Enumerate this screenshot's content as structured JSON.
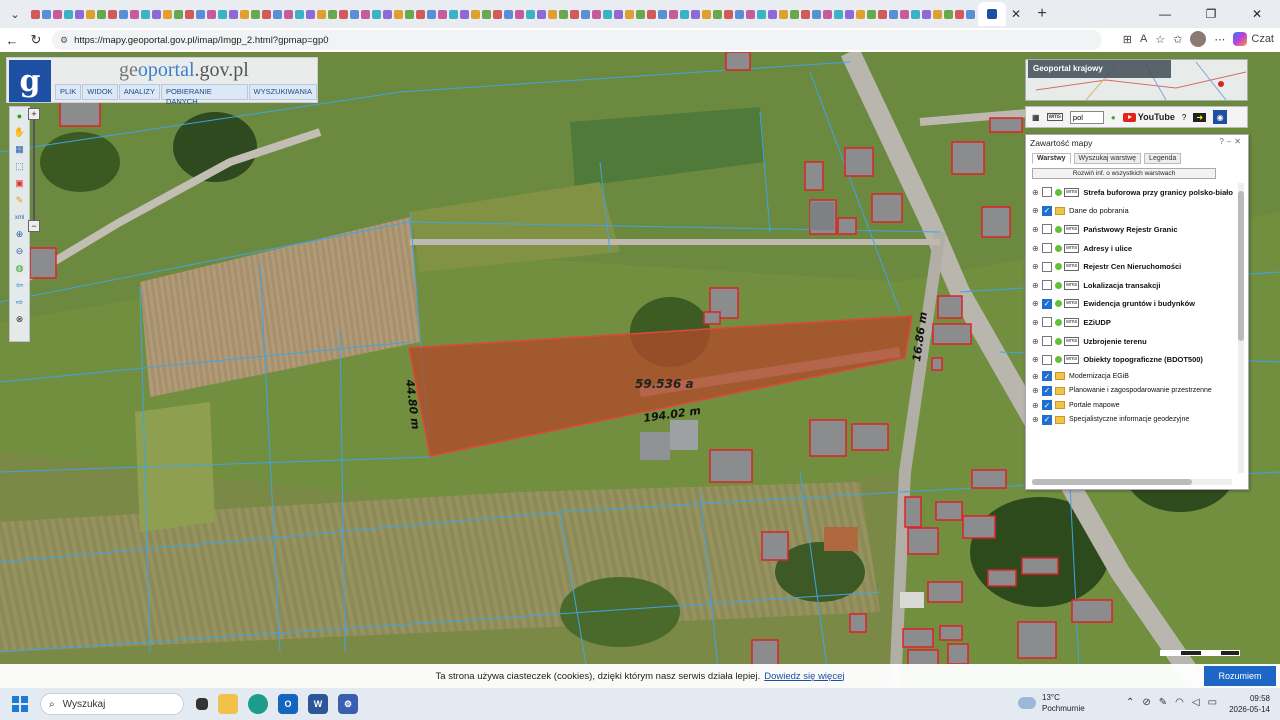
{
  "browser": {
    "active_tab_icon": "geoportal-favicon",
    "url": "https://mapy.geoportal.gov.pl/imap/Imgp_2.html?gpmap=gp0",
    "copilot_label": "Czat"
  },
  "geoportal": {
    "logo_letter": "g",
    "title_prefix": "ge",
    "title_mid": "oportal",
    "title_suffix": ".gov.pl",
    "menu": [
      "PLIK",
      "WIDOK",
      "ANALIZY",
      "POBIERANIE DANYCH",
      "WYSZUKIWANIA"
    ]
  },
  "overview_map": {
    "label": "Geoportal krajowy"
  },
  "utility_bar": {
    "language": "pol",
    "youtube_label": "YouTube"
  },
  "layer_panel": {
    "title": "Zawartość mapy",
    "tabs": [
      "Warstwy",
      "Wyszukaj warstwę",
      "Legenda"
    ],
    "expand_button": "Rozwiń inf. o wszystkich warstwach",
    "layers": [
      {
        "name": "Strefa buforowa przy granicy polsko-biało",
        "checked": false,
        "bold": true,
        "kind": "service"
      },
      {
        "name": "Dane do pobrania",
        "checked": true,
        "bold": false,
        "kind": "folder"
      },
      {
        "name": "Państwowy Rejestr Granic",
        "checked": false,
        "bold": true,
        "kind": "service"
      },
      {
        "name": "Adresy i ulice",
        "checked": false,
        "bold": true,
        "kind": "service"
      },
      {
        "name": "Rejestr Cen Nieruchomości",
        "checked": false,
        "bold": true,
        "kind": "service"
      },
      {
        "name": "Lokalizacja transakcji",
        "checked": false,
        "bold": true,
        "kind": "service"
      },
      {
        "name": "Ewidencja gruntów i budynków",
        "checked": true,
        "bold": true,
        "kind": "service"
      },
      {
        "name": "EZiUDP",
        "checked": false,
        "bold": true,
        "kind": "service"
      },
      {
        "name": "Uzbrojenie terenu",
        "checked": false,
        "bold": true,
        "kind": "service"
      },
      {
        "name": "Obiekty topograficzne (BDOT500)",
        "checked": false,
        "bold": true,
        "kind": "service"
      },
      {
        "name": "Modernizacja EGiB",
        "checked": true,
        "bold": false,
        "kind": "folder"
      },
      {
        "name": "Planowanie i zagospodarowanie przestrzenne",
        "checked": true,
        "bold": false,
        "kind": "folder"
      },
      {
        "name": "Portale mapowe",
        "checked": true,
        "bold": false,
        "kind": "folder"
      },
      {
        "name": "Specjalistyczne informacje geodezyjne",
        "checked": true,
        "bold": false,
        "kind": "folder"
      }
    ]
  },
  "measurement": {
    "area": "59.536 a",
    "side_left": "44.80 m",
    "side_bottom": "194.02 m",
    "side_right": "16.86 m"
  },
  "cookie_banner": {
    "text": "Ta strona używa ciasteczek (cookies), dzięki którym nasz serwis działa lepiej.",
    "link": "Dowiedz się więcej",
    "button": "Rozumiem"
  },
  "taskbar": {
    "search_placeholder": "Wyszukaj",
    "temperature": "13°C",
    "weather_text": "Pochmurnie",
    "time": "09:58",
    "date": "2026-05-14"
  },
  "colors": {
    "parcel_fill": "#b04a2a",
    "parcel_stroke": "#e0463a",
    "building_outline": "#e0202a",
    "parcel_lines": "#3fa4e6",
    "accent": "#1d4fa3"
  }
}
